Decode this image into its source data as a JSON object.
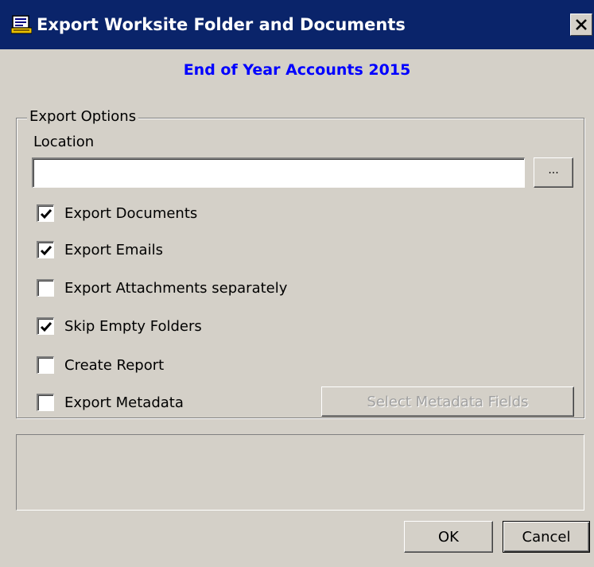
{
  "window": {
    "title": "Export Worksite Folder and Documents",
    "title_bar_color": "#0a246a"
  },
  "header": {
    "subtitle": "End of Year Accounts 2015",
    "subtitle_color": "#0000ff"
  },
  "export_options": {
    "group_label": "Export Options",
    "location_label": "Location",
    "location_value": "",
    "browse_label": "...",
    "checkboxes": [
      {
        "label": "Export Documents",
        "checked": true
      },
      {
        "label": "Export Emails",
        "checked": true
      },
      {
        "label": "Export Attachments separately",
        "checked": false
      },
      {
        "label": "Skip Empty Folders",
        "checked": true
      },
      {
        "label": "Create Report",
        "checked": false
      },
      {
        "label": "Export Metadata",
        "checked": false
      }
    ],
    "select_metadata_label": "Select Metadata Fields"
  },
  "footer": {
    "ok_label": "OK",
    "cancel_label": "Cancel"
  }
}
